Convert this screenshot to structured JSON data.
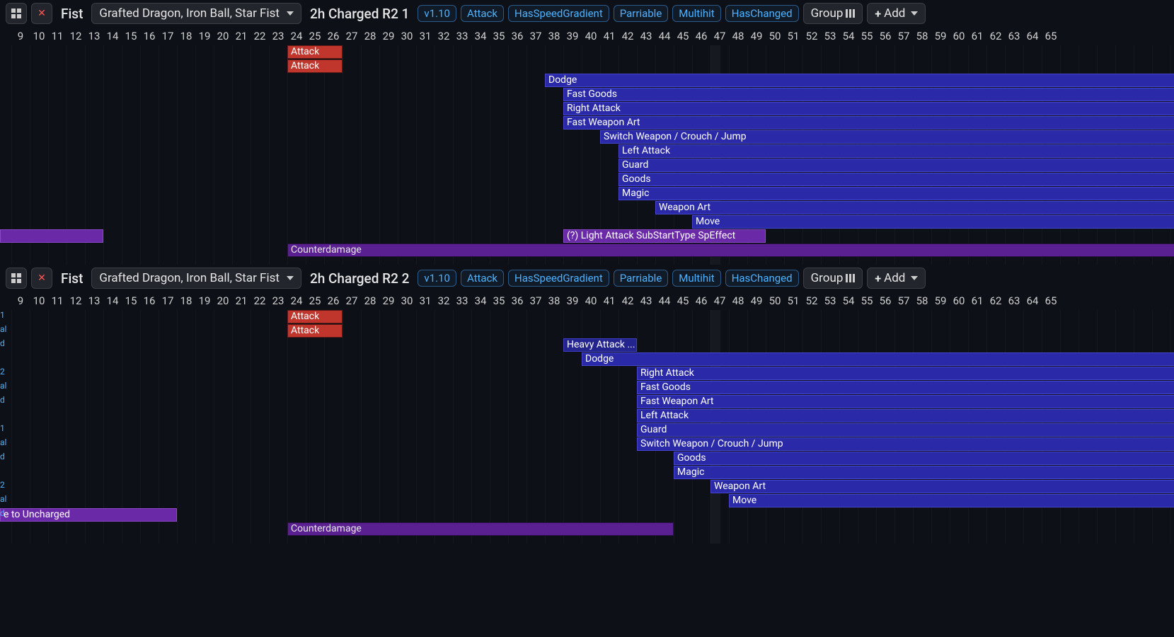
{
  "ruler": {
    "start": 9,
    "end": 65
  },
  "panels": [
    {
      "weapon_class": "Fist",
      "weapon_names": "Grafted Dragon, Iron Ball, Star Fist",
      "move_name": "2h Charged R2 1",
      "tags": [
        "v1.10",
        "Attack",
        "HasSpeedGradient",
        "Parriable",
        "Multihit",
        "HasChanged"
      ],
      "group_label": "Group",
      "add_label": "Add",
      "vline_frame": 47,
      "bars": [
        {
          "label": "Attack",
          "start": 24,
          "end": 27,
          "row": 0,
          "kind": "red"
        },
        {
          "label": "Attack",
          "start": 24,
          "end": 27,
          "row": 1,
          "kind": "red"
        },
        {
          "label": "Dodge",
          "start": 38,
          "end": 120,
          "row": 2,
          "kind": "blue"
        },
        {
          "label": "Fast Goods",
          "start": 39,
          "end": 120,
          "row": 3,
          "kind": "blue"
        },
        {
          "label": "Right Attack",
          "start": 39,
          "end": 120,
          "row": 4,
          "kind": "blue"
        },
        {
          "label": "Fast Weapon Art",
          "start": 39,
          "end": 120,
          "row": 5,
          "kind": "blue"
        },
        {
          "label": "Switch Weapon / Crouch / Jump",
          "start": 41,
          "end": 120,
          "row": 6,
          "kind": "blue"
        },
        {
          "label": "Left Attack",
          "start": 42,
          "end": 120,
          "row": 7,
          "kind": "blue"
        },
        {
          "label": "Guard",
          "start": 42,
          "end": 120,
          "row": 8,
          "kind": "blue"
        },
        {
          "label": "Goods",
          "start": 42,
          "end": 120,
          "row": 9,
          "kind": "blue"
        },
        {
          "label": "Magic",
          "start": 42,
          "end": 120,
          "row": 10,
          "kind": "blue"
        },
        {
          "label": "Weapon Art",
          "start": 44,
          "end": 120,
          "row": 11,
          "kind": "blue"
        },
        {
          "label": "Move",
          "start": 46,
          "end": 120,
          "row": 12,
          "kind": "blue"
        },
        {
          "label": "",
          "start": 0,
          "end": 14,
          "row": 13,
          "kind": "purple"
        },
        {
          "label": "(?) Light Attack SubStartType SpEffect",
          "start": 39,
          "end": 50,
          "row": 13,
          "kind": "purple"
        },
        {
          "label": "Counterdamage",
          "start": 24,
          "end": 120,
          "row": 14,
          "kind": "purple-dark"
        }
      ],
      "side_labels": []
    },
    {
      "weapon_class": "Fist",
      "weapon_names": "Grafted Dragon, Iron Ball, Star Fist",
      "move_name": "2h Charged R2 2",
      "tags": [
        "v1.10",
        "Attack",
        "HasSpeedGradient",
        "Parriable",
        "Multihit",
        "HasChanged"
      ],
      "group_label": "Group",
      "add_label": "Add",
      "vline_frame": 47,
      "bars": [
        {
          "label": "Attack",
          "start": 24,
          "end": 27,
          "row": 0,
          "kind": "red"
        },
        {
          "label": "Attack",
          "start": 24,
          "end": 27,
          "row": 1,
          "kind": "red"
        },
        {
          "label": "Heavy Attack ...",
          "start": 39,
          "end": 43,
          "row": 2,
          "kind": "blue-dark"
        },
        {
          "label": "Dodge",
          "start": 40,
          "end": 120,
          "row": 3,
          "kind": "blue"
        },
        {
          "label": "Right Attack",
          "start": 43,
          "end": 120,
          "row": 4,
          "kind": "blue"
        },
        {
          "label": "Fast Goods",
          "start": 43,
          "end": 120,
          "row": 5,
          "kind": "blue"
        },
        {
          "label": "Fast Weapon Art",
          "start": 43,
          "end": 120,
          "row": 6,
          "kind": "blue"
        },
        {
          "label": "Left Attack",
          "start": 43,
          "end": 120,
          "row": 7,
          "kind": "blue"
        },
        {
          "label": "Guard",
          "start": 43,
          "end": 120,
          "row": 8,
          "kind": "blue"
        },
        {
          "label": "Switch Weapon / Crouch / Jump",
          "start": 43,
          "end": 120,
          "row": 9,
          "kind": "blue"
        },
        {
          "label": "Goods",
          "start": 45,
          "end": 120,
          "row": 10,
          "kind": "blue"
        },
        {
          "label": "Magic",
          "start": 45,
          "end": 120,
          "row": 11,
          "kind": "blue"
        },
        {
          "label": "Weapon Art",
          "start": 47,
          "end": 120,
          "row": 12,
          "kind": "blue"
        },
        {
          "label": "Move",
          "start": 48,
          "end": 120,
          "row": 13,
          "kind": "blue"
        },
        {
          "label": "e to Uncharged",
          "start": 0,
          "end": 18,
          "row": 14,
          "kind": "purple",
          "textpad": 0
        },
        {
          "label": "Counterdamage",
          "start": 24,
          "end": 45,
          "row": 15,
          "kind": "purple-dark"
        }
      ],
      "side_labels": [
        {
          "row": 0,
          "text": "1"
        },
        {
          "row": 1,
          "text": "al"
        },
        {
          "row": 2,
          "text": "d"
        },
        {
          "row": 4,
          "text": "2"
        },
        {
          "row": 5,
          "text": "al"
        },
        {
          "row": 6,
          "text": "d"
        },
        {
          "row": 8,
          "text": "1"
        },
        {
          "row": 9,
          "text": "al"
        },
        {
          "row": 10,
          "text": "d"
        },
        {
          "row": 12,
          "text": "2"
        },
        {
          "row": 13,
          "text": "al"
        },
        {
          "row": 14,
          "text": "d"
        }
      ]
    }
  ]
}
